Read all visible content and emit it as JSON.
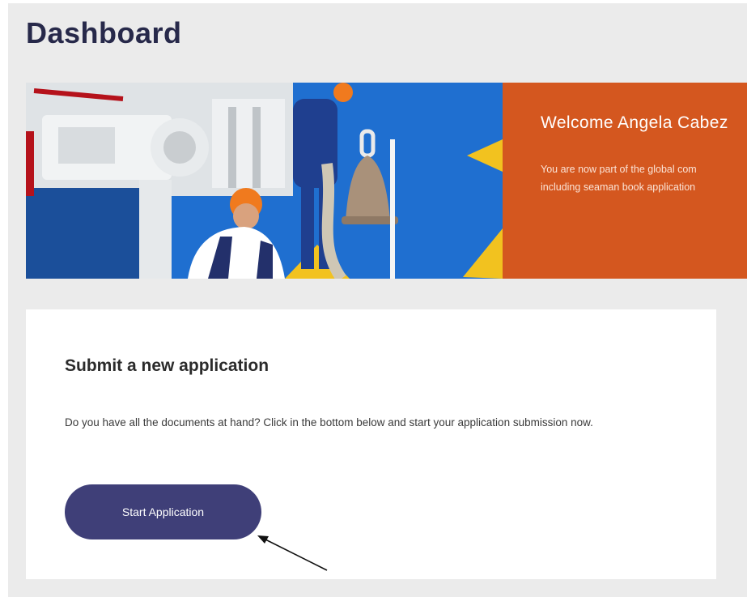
{
  "header": {
    "title": "Dashboard"
  },
  "hero": {
    "welcome_title": "Welcome Angela Cabez",
    "welcome_line1": "You are now part of the global com",
    "welcome_line2": "including seaman book application",
    "panel_color": "#d4571f"
  },
  "card": {
    "title": "Submit a new application",
    "description": "Do you have all the documents at hand? Click in the bottom below and start your application submission now.",
    "button_label": "Start Application",
    "button_color": "#3f3f78"
  },
  "annotation": {
    "icon": "arrow-pointer-icon"
  }
}
